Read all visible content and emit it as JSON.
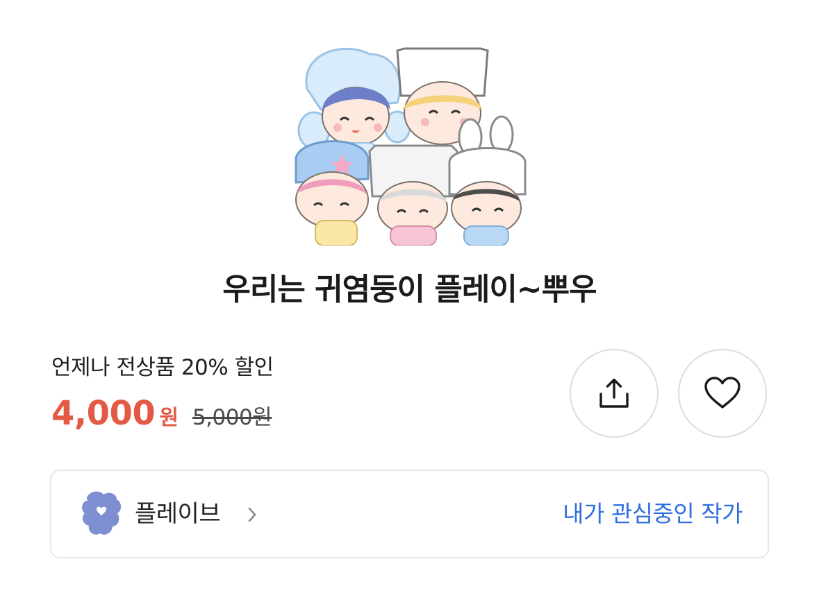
{
  "product": {
    "title": "우리는 귀염둥이 플레이~뿌우",
    "image_icon": "sticker-characters-image"
  },
  "pricing": {
    "promo_text": "언제나 전상품 20% 할인",
    "price_value": "4,000",
    "price_unit": "원",
    "original_price": "5,000원",
    "accent_color": "#e25a45"
  },
  "actions": {
    "share_icon": "share-icon",
    "like_icon": "heart-icon"
  },
  "artist": {
    "name": "플레이브",
    "avatar_icon": "artist-avatar-icon",
    "chevron_icon": "chevron-right-icon",
    "follow_label": "내가 관심중인 작가",
    "link_color": "#2f6ee0"
  }
}
